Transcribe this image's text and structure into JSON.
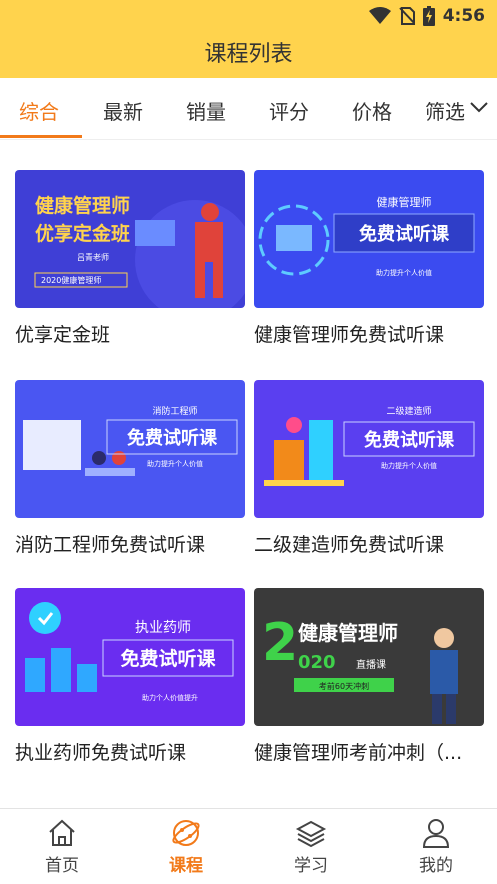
{
  "status": {
    "time": "4:56"
  },
  "header": {
    "title": "课程列表"
  },
  "tabs": [
    "综合",
    "最新",
    "销量",
    "评分",
    "价格",
    "筛选"
  ],
  "courses": [
    {
      "title": "优享定金班",
      "banner": [
        "健康管理师",
        "优享定金班",
        "吕青老师",
        "2020健康管理师"
      ]
    },
    {
      "title": "健康管理师免费试听课",
      "banner": [
        "健康管理师",
        "免费试听课",
        "助力提升个人价值"
      ]
    },
    {
      "title": "消防工程师免费试听课",
      "banner": [
        "消防工程师",
        "免费试听课",
        "助力提升个人价值"
      ]
    },
    {
      "title": "二级建造师免费试听课",
      "banner": [
        "二级建造师",
        "免费试听课",
        "助力提升个人价值"
      ]
    },
    {
      "title": "执业药师免费试听课",
      "banner": [
        "执业药师",
        "免费试听课",
        "助力个人价值提升"
      ]
    },
    {
      "title": "健康管理师考前冲刺（...",
      "banner": [
        "健康管理师",
        "2",
        "020",
        "直播课",
        "考前60天冲刺"
      ]
    }
  ],
  "nav": [
    {
      "label": "首页",
      "icon": "home-icon"
    },
    {
      "label": "课程",
      "icon": "planet-icon"
    },
    {
      "label": "学习",
      "icon": "layers-icon"
    },
    {
      "label": "我的",
      "icon": "user-icon"
    }
  ],
  "colors": {
    "accent": "#f27a1a",
    "header": "#ffd34d",
    "banner_blue": "#3b4bf0",
    "banner_dark": "#3a3a3a"
  }
}
